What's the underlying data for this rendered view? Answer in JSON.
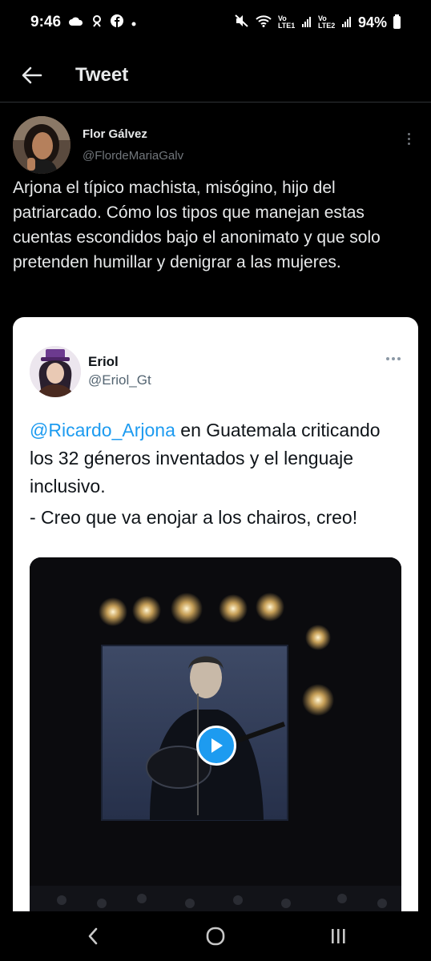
{
  "status_bar": {
    "time": "9:46",
    "sim1_label": "Vo LTE1",
    "sim2_label": "Vo LTE2",
    "battery": "94%"
  },
  "header": {
    "title": "Tweet"
  },
  "tweet": {
    "author_name": "Flor Gálvez",
    "author_handle": "@FlordeMariaGalv",
    "text": "Arjona el típico machista, misógino, hijo del patriarcado. Cómo los tipos que manejan estas  cuentas escondidos bajo el anonimato y que solo pretenden humillar y denigrar a las mujeres."
  },
  "quoted_tweet": {
    "author_name": "Eriol",
    "author_handle": "@Eriol_Gt",
    "mention": "@Ricardo_Arjona",
    "text_after_mention": " en Guatemala criticando los 32 géneros inventados y el lenguaje inclusivo.",
    "second_line": "- Creo que va enojar a los chairos, creo!"
  },
  "colors": {
    "background": "#000000",
    "accent": "#1d9bf0",
    "text_primary": "#e7e9ea",
    "text_secondary": "#71767b"
  },
  "icons": {
    "back": "arrow-left-icon",
    "more": "more-vertical-icon",
    "play": "play-icon",
    "nav_back": "chevron-left-icon",
    "nav_home": "circle-home-icon",
    "nav_recents": "recents-icon"
  }
}
